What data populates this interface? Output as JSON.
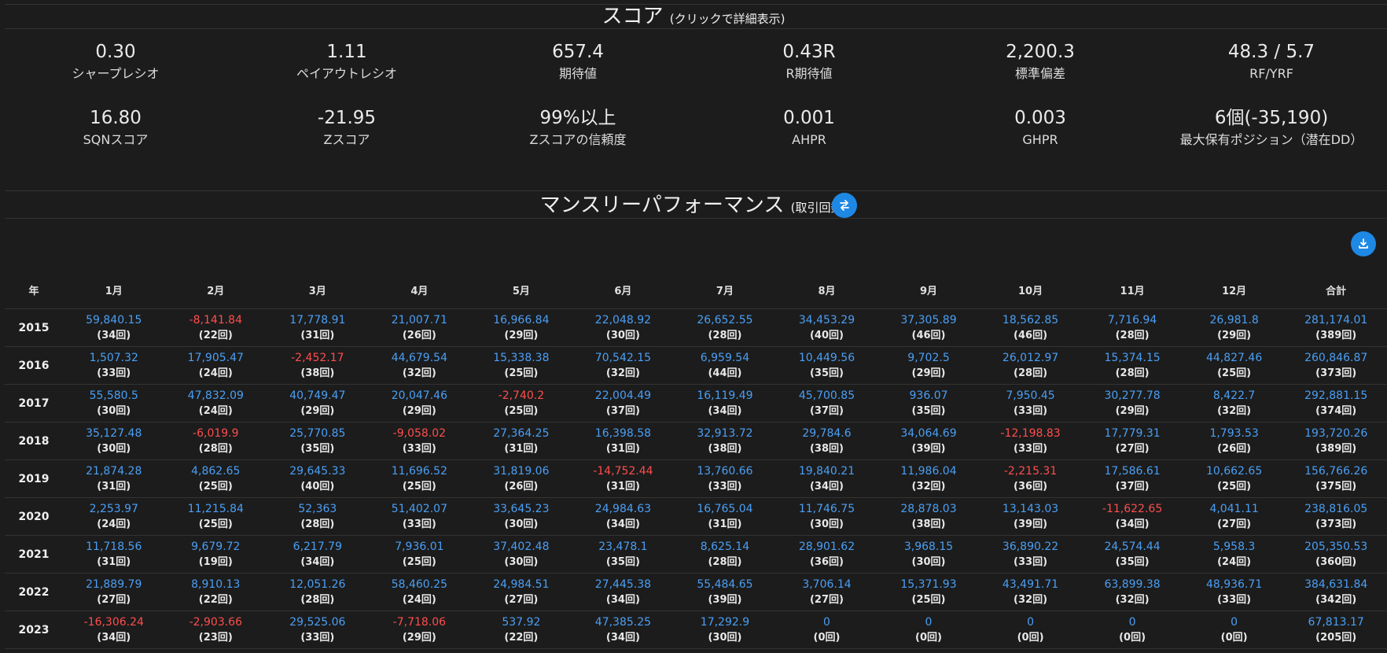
{
  "score_section": {
    "title": "スコア",
    "subtitle": "(クリックで詳細表示)",
    "metrics": [
      {
        "value": "0.30",
        "label": "シャープレシオ"
      },
      {
        "value": "1.11",
        "label": "ペイアウトレシオ"
      },
      {
        "value": "657.4",
        "label": "期待値"
      },
      {
        "value": "0.43R",
        "label": "R期待値"
      },
      {
        "value": "2,200.3",
        "label": "標準偏差"
      },
      {
        "value": "48.3 / 5.7",
        "label": "RF/YRF"
      },
      {
        "value": "16.80",
        "label": "SQNスコア"
      },
      {
        "value": "-21.95",
        "label": "Zスコア"
      },
      {
        "value": "99%以上",
        "label": "Zスコアの信頼度"
      },
      {
        "value": "0.001",
        "label": "AHPR"
      },
      {
        "value": "0.003",
        "label": "GHPR"
      },
      {
        "value": "6個(-35,190)",
        "label": "最大保有ポジション（潜在DD）"
      }
    ]
  },
  "monthly_section": {
    "title": "マンスリーパフォーマンス",
    "subtitle": "(取引回数)",
    "swap_icon": "swap-icon",
    "download_icon": "download-icon",
    "headers": [
      "年",
      "1月",
      "2月",
      "3月",
      "4月",
      "5月",
      "6月",
      "7月",
      "8月",
      "9月",
      "10月",
      "11月",
      "12月",
      "合計"
    ],
    "rows": [
      {
        "year": "2015",
        "cells": [
          {
            "v": "59,840.15",
            "c": "(34回)",
            "neg": false
          },
          {
            "v": "-8,141.84",
            "c": "(22回)",
            "neg": true
          },
          {
            "v": "17,778.91",
            "c": "(31回)",
            "neg": false
          },
          {
            "v": "21,007.71",
            "c": "(26回)",
            "neg": false
          },
          {
            "v": "16,966.84",
            "c": "(29回)",
            "neg": false
          },
          {
            "v": "22,048.92",
            "c": "(30回)",
            "neg": false
          },
          {
            "v": "26,652.55",
            "c": "(28回)",
            "neg": false
          },
          {
            "v": "34,453.29",
            "c": "(40回)",
            "neg": false
          },
          {
            "v": "37,305.89",
            "c": "(46回)",
            "neg": false
          },
          {
            "v": "18,562.85",
            "c": "(46回)",
            "neg": false
          },
          {
            "v": "7,716.94",
            "c": "(28回)",
            "neg": false
          },
          {
            "v": "26,981.8",
            "c": "(29回)",
            "neg": false
          },
          {
            "v": "281,174.01",
            "c": "(389回)",
            "neg": false
          }
        ]
      },
      {
        "year": "2016",
        "cells": [
          {
            "v": "1,507.32",
            "c": "(33回)",
            "neg": false
          },
          {
            "v": "17,905.47",
            "c": "(24回)",
            "neg": false
          },
          {
            "v": "-2,452.17",
            "c": "(38回)",
            "neg": true
          },
          {
            "v": "44,679.54",
            "c": "(32回)",
            "neg": false
          },
          {
            "v": "15,338.38",
            "c": "(25回)",
            "neg": false
          },
          {
            "v": "70,542.15",
            "c": "(32回)",
            "neg": false
          },
          {
            "v": "6,959.54",
            "c": "(44回)",
            "neg": false
          },
          {
            "v": "10,449.56",
            "c": "(35回)",
            "neg": false
          },
          {
            "v": "9,702.5",
            "c": "(29回)",
            "neg": false
          },
          {
            "v": "26,012.97",
            "c": "(28回)",
            "neg": false
          },
          {
            "v": "15,374.15",
            "c": "(28回)",
            "neg": false
          },
          {
            "v": "44,827.46",
            "c": "(25回)",
            "neg": false
          },
          {
            "v": "260,846.87",
            "c": "(373回)",
            "neg": false
          }
        ]
      },
      {
        "year": "2017",
        "cells": [
          {
            "v": "55,580.5",
            "c": "(30回)",
            "neg": false
          },
          {
            "v": "47,832.09",
            "c": "(24回)",
            "neg": false
          },
          {
            "v": "40,749.47",
            "c": "(29回)",
            "neg": false
          },
          {
            "v": "20,047.46",
            "c": "(29回)",
            "neg": false
          },
          {
            "v": "-2,740.2",
            "c": "(25回)",
            "neg": true
          },
          {
            "v": "22,004.49",
            "c": "(37回)",
            "neg": false
          },
          {
            "v": "16,119.49",
            "c": "(34回)",
            "neg": false
          },
          {
            "v": "45,700.85",
            "c": "(37回)",
            "neg": false
          },
          {
            "v": "936.07",
            "c": "(35回)",
            "neg": false
          },
          {
            "v": "7,950.45",
            "c": "(33回)",
            "neg": false
          },
          {
            "v": "30,277.78",
            "c": "(29回)",
            "neg": false
          },
          {
            "v": "8,422.7",
            "c": "(32回)",
            "neg": false
          },
          {
            "v": "292,881.15",
            "c": "(374回)",
            "neg": false
          }
        ]
      },
      {
        "year": "2018",
        "cells": [
          {
            "v": "35,127.48",
            "c": "(30回)",
            "neg": false
          },
          {
            "v": "-6,019.9",
            "c": "(28回)",
            "neg": true
          },
          {
            "v": "25,770.85",
            "c": "(35回)",
            "neg": false
          },
          {
            "v": "-9,058.02",
            "c": "(33回)",
            "neg": true
          },
          {
            "v": "27,364.25",
            "c": "(31回)",
            "neg": false
          },
          {
            "v": "16,398.58",
            "c": "(31回)",
            "neg": false
          },
          {
            "v": "32,913.72",
            "c": "(38回)",
            "neg": false
          },
          {
            "v": "29,784.6",
            "c": "(38回)",
            "neg": false
          },
          {
            "v": "34,064.69",
            "c": "(39回)",
            "neg": false
          },
          {
            "v": "-12,198.83",
            "c": "(33回)",
            "neg": true
          },
          {
            "v": "17,779.31",
            "c": "(27回)",
            "neg": false
          },
          {
            "v": "1,793.53",
            "c": "(26回)",
            "neg": false
          },
          {
            "v": "193,720.26",
            "c": "(389回)",
            "neg": false
          }
        ]
      },
      {
        "year": "2019",
        "cells": [
          {
            "v": "21,874.28",
            "c": "(31回)",
            "neg": false
          },
          {
            "v": "4,862.65",
            "c": "(25回)",
            "neg": false
          },
          {
            "v": "29,645.33",
            "c": "(40回)",
            "neg": false
          },
          {
            "v": "11,696.52",
            "c": "(25回)",
            "neg": false
          },
          {
            "v": "31,819.06",
            "c": "(26回)",
            "neg": false
          },
          {
            "v": "-14,752.44",
            "c": "(31回)",
            "neg": true
          },
          {
            "v": "13,760.66",
            "c": "(33回)",
            "neg": false
          },
          {
            "v": "19,840.21",
            "c": "(34回)",
            "neg": false
          },
          {
            "v": "11,986.04",
            "c": "(32回)",
            "neg": false
          },
          {
            "v": "-2,215.31",
            "c": "(36回)",
            "neg": true
          },
          {
            "v": "17,586.61",
            "c": "(37回)",
            "neg": false
          },
          {
            "v": "10,662.65",
            "c": "(25回)",
            "neg": false
          },
          {
            "v": "156,766.26",
            "c": "(375回)",
            "neg": false
          }
        ]
      },
      {
        "year": "2020",
        "cells": [
          {
            "v": "2,253.97",
            "c": "(24回)",
            "neg": false
          },
          {
            "v": "11,215.84",
            "c": "(25回)",
            "neg": false
          },
          {
            "v": "52,363",
            "c": "(28回)",
            "neg": false
          },
          {
            "v": "51,402.07",
            "c": "(33回)",
            "neg": false
          },
          {
            "v": "33,645.23",
            "c": "(30回)",
            "neg": false
          },
          {
            "v": "24,984.63",
            "c": "(34回)",
            "neg": false
          },
          {
            "v": "16,765.04",
            "c": "(31回)",
            "neg": false
          },
          {
            "v": "11,746.75",
            "c": "(30回)",
            "neg": false
          },
          {
            "v": "28,878.03",
            "c": "(38回)",
            "neg": false
          },
          {
            "v": "13,143.03",
            "c": "(39回)",
            "neg": false
          },
          {
            "v": "-11,622.65",
            "c": "(34回)",
            "neg": true
          },
          {
            "v": "4,041.11",
            "c": "(27回)",
            "neg": false
          },
          {
            "v": "238,816.05",
            "c": "(373回)",
            "neg": false
          }
        ]
      },
      {
        "year": "2021",
        "cells": [
          {
            "v": "11,718.56",
            "c": "(31回)",
            "neg": false
          },
          {
            "v": "9,679.72",
            "c": "(19回)",
            "neg": false
          },
          {
            "v": "6,217.79",
            "c": "(34回)",
            "neg": false
          },
          {
            "v": "7,936.01",
            "c": "(25回)",
            "neg": false
          },
          {
            "v": "37,402.48",
            "c": "(30回)",
            "neg": false
          },
          {
            "v": "23,478.1",
            "c": "(35回)",
            "neg": false
          },
          {
            "v": "8,625.14",
            "c": "(28回)",
            "neg": false
          },
          {
            "v": "28,901.62",
            "c": "(36回)",
            "neg": false
          },
          {
            "v": "3,968.15",
            "c": "(30回)",
            "neg": false
          },
          {
            "v": "36,890.22",
            "c": "(33回)",
            "neg": false
          },
          {
            "v": "24,574.44",
            "c": "(35回)",
            "neg": false
          },
          {
            "v": "5,958.3",
            "c": "(24回)",
            "neg": false
          },
          {
            "v": "205,350.53",
            "c": "(360回)",
            "neg": false
          }
        ]
      },
      {
        "year": "2022",
        "cells": [
          {
            "v": "21,889.79",
            "c": "(27回)",
            "neg": false
          },
          {
            "v": "8,910.13",
            "c": "(22回)",
            "neg": false
          },
          {
            "v": "12,051.26",
            "c": "(28回)",
            "neg": false
          },
          {
            "v": "58,460.25",
            "c": "(24回)",
            "neg": false
          },
          {
            "v": "24,984.51",
            "c": "(27回)",
            "neg": false
          },
          {
            "v": "27,445.38",
            "c": "(34回)",
            "neg": false
          },
          {
            "v": "55,484.65",
            "c": "(39回)",
            "neg": false
          },
          {
            "v": "3,706.14",
            "c": "(27回)",
            "neg": false
          },
          {
            "v": "15,371.93",
            "c": "(25回)",
            "neg": false
          },
          {
            "v": "43,491.71",
            "c": "(32回)",
            "neg": false
          },
          {
            "v": "63,899.38",
            "c": "(32回)",
            "neg": false
          },
          {
            "v": "48,936.71",
            "c": "(33回)",
            "neg": false
          },
          {
            "v": "384,631.84",
            "c": "(342回)",
            "neg": false
          }
        ]
      },
      {
        "year": "2023",
        "cells": [
          {
            "v": "-16,306.24",
            "c": "(34回)",
            "neg": true
          },
          {
            "v": "-2,903.66",
            "c": "(23回)",
            "neg": true
          },
          {
            "v": "29,525.06",
            "c": "(33回)",
            "neg": false
          },
          {
            "v": "-7,718.06",
            "c": "(29回)",
            "neg": true
          },
          {
            "v": "537.92",
            "c": "(22回)",
            "neg": false
          },
          {
            "v": "47,385.25",
            "c": "(34回)",
            "neg": false
          },
          {
            "v": "17,292.9",
            "c": "(30回)",
            "neg": false
          },
          {
            "v": "0",
            "c": "(0回)",
            "neg": false
          },
          {
            "v": "0",
            "c": "(0回)",
            "neg": false
          },
          {
            "v": "0",
            "c": "(0回)",
            "neg": false
          },
          {
            "v": "0",
            "c": "(0回)",
            "neg": false
          },
          {
            "v": "0",
            "c": "(0回)",
            "neg": false
          },
          {
            "v": "67,813.17",
            "c": "(205回)",
            "neg": false
          }
        ]
      }
    ]
  },
  "colors": {
    "background": "#1c1c1c",
    "positive": "#4a9ff5",
    "negative": "#ff4d4d",
    "accent": "#1e88e5"
  }
}
